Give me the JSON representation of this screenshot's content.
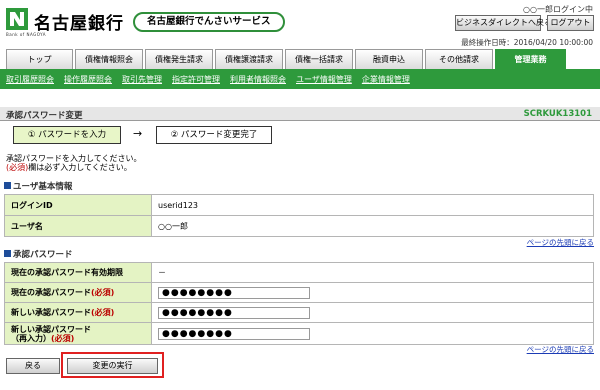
{
  "header": {
    "bank_name": "名古屋銀行",
    "bank_sub": "Bank of NAGOYA",
    "service": "名古屋銀行でんさいサービス",
    "user": "○○一郎ログイン中",
    "btn_sd": "ビジネスダイレクトへ戻る",
    "btn_logout": "ログアウト",
    "last_op": "最終操作日時：2016/04/20 10:00:00"
  },
  "tabs": [
    {
      "label": "トップ"
    },
    {
      "label": "債権情報照会"
    },
    {
      "label": "債権発生請求"
    },
    {
      "label": "債権譲渡請求"
    },
    {
      "label": "債権一括請求"
    },
    {
      "label": "融資申込"
    },
    {
      "label": "その他請求"
    },
    {
      "label": "管理業務"
    }
  ],
  "subnav": [
    "取引履歴照会",
    "操作履歴照会",
    "取引先管理",
    "指定許可管理",
    "利用者情報照会",
    "ユーザ情報管理",
    "企業情報管理"
  ],
  "page": {
    "title": "承認パスワード変更",
    "screen_id": "SCRKUK13101"
  },
  "steps": {
    "step1": "① パスワードを入力",
    "arrow": "→",
    "step2": "② パスワード変更完了"
  },
  "instructions": {
    "line1": "承認パスワードを入力してください。",
    "req": "(必須)",
    "line2_rest": "欄は必ず入力してください。"
  },
  "user_info": {
    "heading": "ユーザ基本情報",
    "rows": [
      {
        "label": "ログインID",
        "value": "userid123"
      },
      {
        "label": "ユーザ名",
        "value": "○○一郎"
      }
    ]
  },
  "links": {
    "to_top": "ページの先頭に戻る"
  },
  "password": {
    "heading": "承認パスワード",
    "expiry_label": "現在の承認パスワード有効期限",
    "expiry_value": "－",
    "current_label": "現在の承認パスワード",
    "new_label": "新しい承認パスワード",
    "confirm_label": "新しい承認パスワード",
    "confirm_label2": "（再入力）",
    "req": "(必須)",
    "current_value": "●●●●●●●●",
    "new_value": "●●●●●●●●",
    "confirm_value": "●●●●●●●●"
  },
  "buttons": {
    "back": "戻る",
    "execute": "変更の実行"
  },
  "colors": {
    "green": "#2e9a3c",
    "link": "#1c3cb5",
    "required": "#b00000",
    "highlight": "#e02020"
  }
}
